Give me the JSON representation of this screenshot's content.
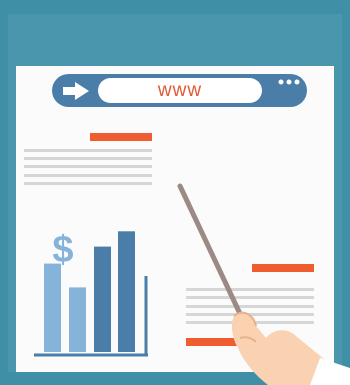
{
  "browser": {
    "url_text": "www",
    "back_icon": "arrow-right-icon",
    "menu_icon": "more-dots-icon"
  },
  "colors": {
    "background": "#3f8fa7",
    "board": "#fbfbfb",
    "browser_bar": "#4a7ea9",
    "accent": "#ef5c2f",
    "chart_dark": "#4a7ea9",
    "chart_light": "#86b3d9",
    "text_lines": "#d6d6d6"
  },
  "chart": {
    "symbol": "$",
    "bar_levels": [
      0.52,
      0.38,
      0.62,
      0.71
    ]
  }
}
